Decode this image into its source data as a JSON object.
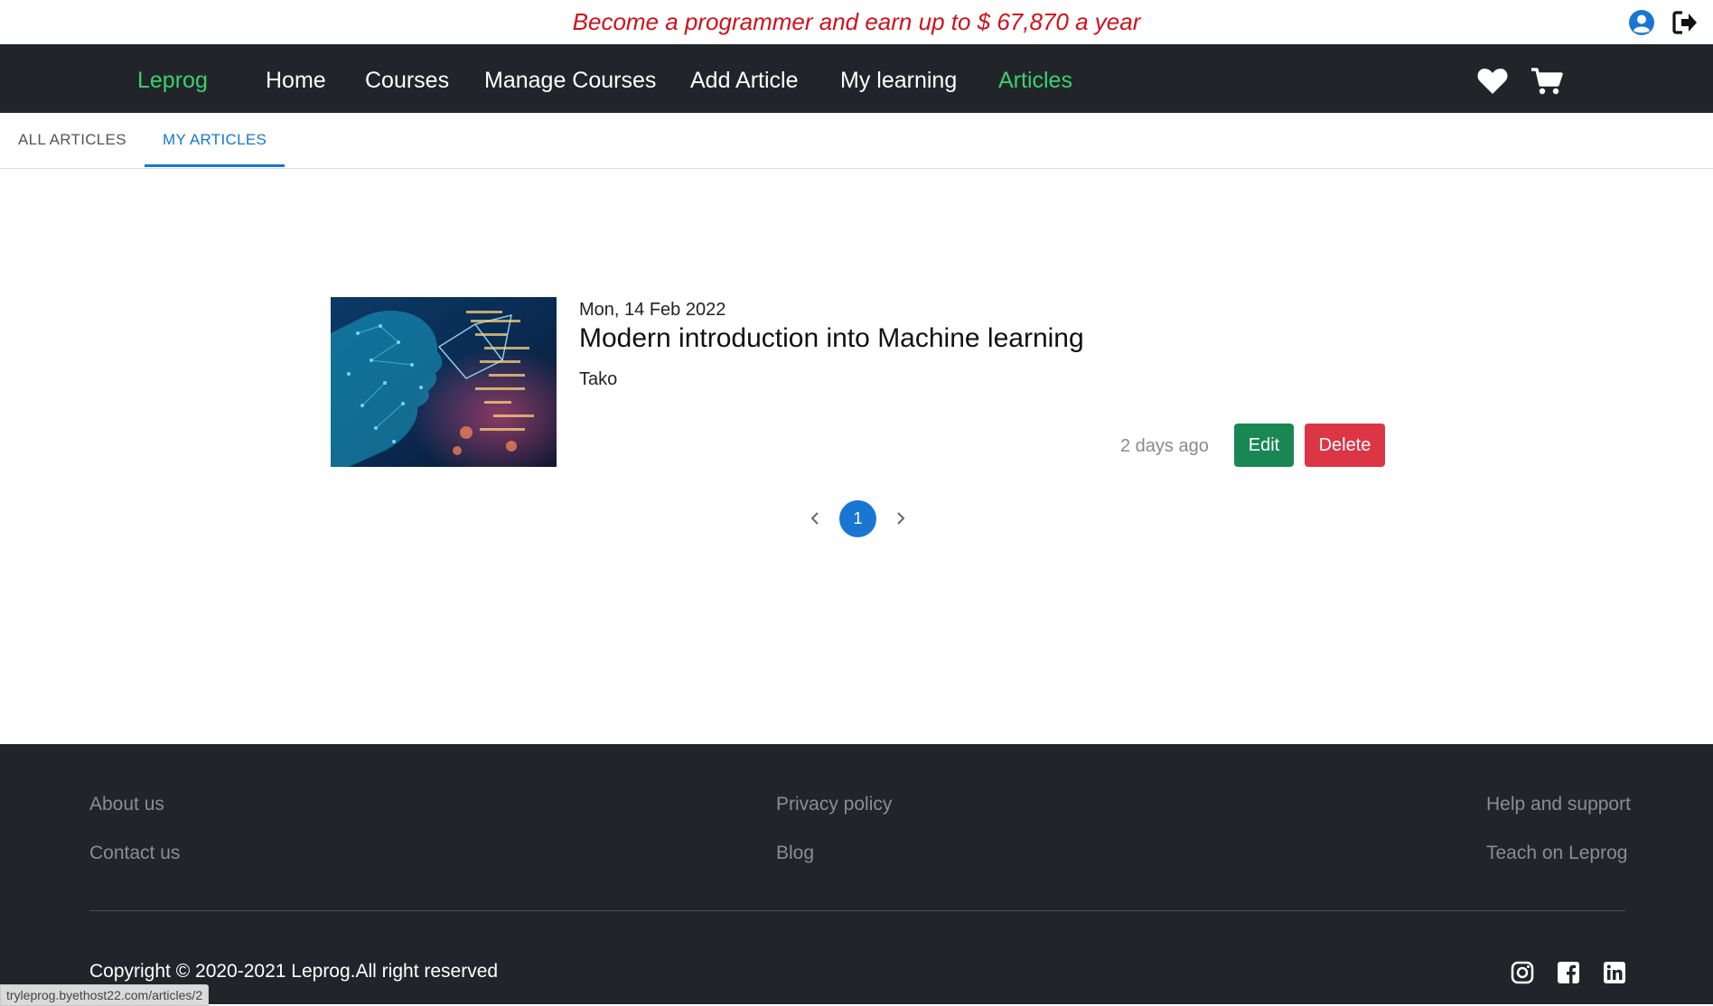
{
  "banner": {
    "text": "Become a programmer and earn up to $ 67,870 a year",
    "icons": [
      "user-circle-icon",
      "sign-out-icon"
    ]
  },
  "navbar": {
    "brand": "Leprog",
    "links": [
      "Home",
      "Courses",
      "Manage Courses",
      "Add Article",
      "My learning",
      "Articles"
    ],
    "active": "Articles",
    "icons": [
      "heart-icon",
      "cart-icon"
    ]
  },
  "tabs": {
    "items": [
      "All articles",
      "My articles"
    ],
    "active": "My articles"
  },
  "article": {
    "date": "Mon, 14 Feb 2022",
    "title": "Modern introduction into Machine learning",
    "author": "Tako",
    "posted": "2 days ago",
    "edit_label": "Edit",
    "delete_label": "Delete"
  },
  "pagination": {
    "current": "1",
    "prev_icon": "chevron-left-icon",
    "next_icon": "chevron-right-icon"
  },
  "footer": {
    "col1": [
      "About us",
      "Contact us"
    ],
    "col2": [
      "Privacy policy",
      "Blog"
    ],
    "col3": [
      "Help and support",
      "Teach on Leprog"
    ],
    "copyright": "Copyright © 2020-2021 Leprog.All right reserved",
    "social": [
      "instagram-icon",
      "facebook-icon",
      "linkedin-icon"
    ]
  },
  "status_bar": {
    "url": "tryleprog.byethost22.com/articles/2"
  },
  "colors": {
    "banner_text": "#d0101a",
    "navbar_bg": "#212529",
    "accent_green": "#3ccf6e",
    "tab_active": "#1976d2",
    "edit_button": "#198754",
    "delete_button": "#dc3545"
  }
}
